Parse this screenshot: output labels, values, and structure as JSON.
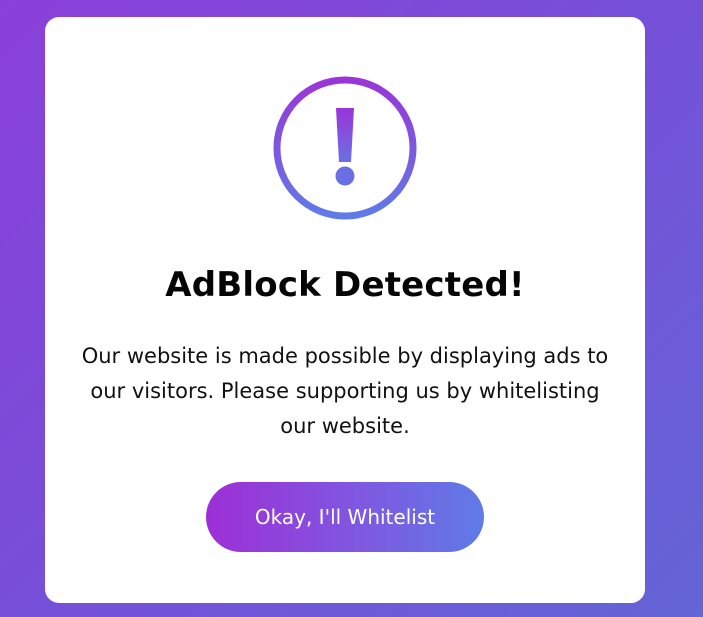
{
  "dialog": {
    "title": "AdBlock Detected!",
    "message": "Our website is made possible by displaying ads to our visitors. Please supporting us by whitelisting our website.",
    "button_label": "Okay, I'll Whitelist",
    "icon": "exclamation-circle-icon"
  },
  "colors": {
    "background_start": "#8a3fd9",
    "background_end": "#6465d6",
    "card": "#ffffff",
    "accent_purple": "#9d2fd6",
    "accent_blue": "#5f7be6",
    "title_text": "#050505"
  }
}
